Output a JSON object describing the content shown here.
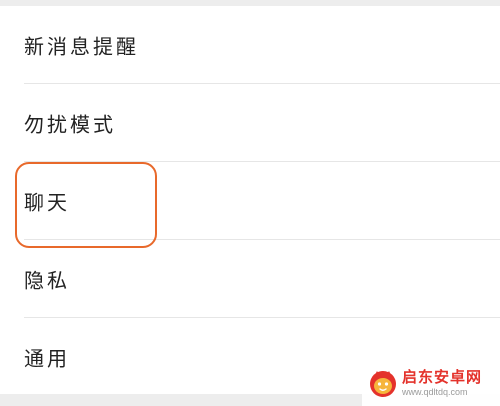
{
  "settings": {
    "items": [
      {
        "label": "新消息提醒"
      },
      {
        "label": "勿扰模式"
      },
      {
        "label": "聊天"
      },
      {
        "label": "隐私"
      },
      {
        "label": "通用"
      }
    ]
  },
  "annotation": {
    "highlight_color": "#e8692b",
    "highlighted_item": "聊天"
  },
  "watermark": {
    "title": "启东安卓网",
    "url": "www.qdltdq.com",
    "logo_icon": "cat-logo-icon",
    "brand_color": "#e4322b"
  }
}
